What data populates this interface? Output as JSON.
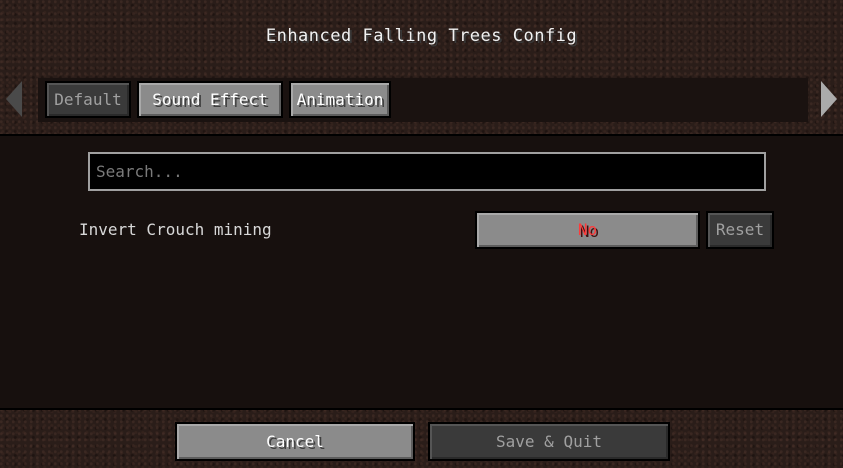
{
  "screen": {
    "title": "Enhanced Falling Trees Config"
  },
  "tabs": [
    {
      "label": "Default",
      "state": "selected"
    },
    {
      "label": "Sound Effect",
      "state": "normal"
    },
    {
      "label": "Animation",
      "state": "normal"
    }
  ],
  "tab_scroll": {
    "left_icon": "triangle-left-icon",
    "right_icon": "triangle-right-icon"
  },
  "search": {
    "placeholder": "Search...",
    "value": ""
  },
  "options": [
    {
      "label": "Invert Crouch mining",
      "value": "No",
      "value_color": "#ff3a3a",
      "reset_label": "Reset",
      "reset_enabled": false
    }
  ],
  "footer": {
    "cancel_label": "Cancel",
    "save_label": "Save & Quit",
    "save_enabled": false
  }
}
